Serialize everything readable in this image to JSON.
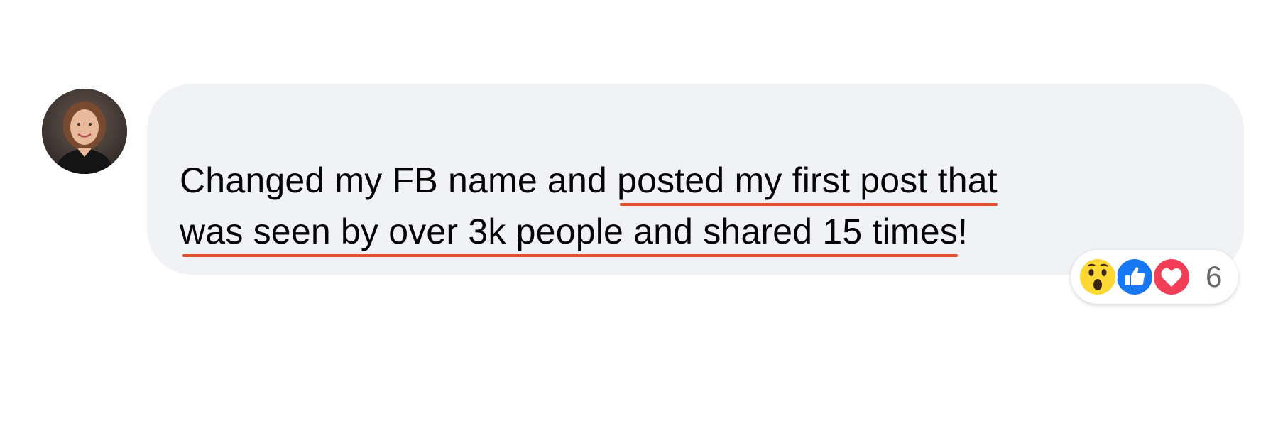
{
  "comment": {
    "text_line1_plain": "Changed my FB name and ",
    "text_line1_highlight": "posted my first post that",
    "text_line2_highlight": "was seen by over 3k people and shared 15 times",
    "text_line2_tail": "!"
  },
  "reactions": {
    "icons": [
      "wow-reaction-icon",
      "like-reaction-icon",
      "love-reaction-icon"
    ],
    "count": "6"
  },
  "colors": {
    "bubble_background": "#f0f2f5",
    "highlight_underline": "#e0522a",
    "like_blue": "#1877f2",
    "love_red": "#f33e58",
    "wow_yellow": "#fdd835"
  }
}
